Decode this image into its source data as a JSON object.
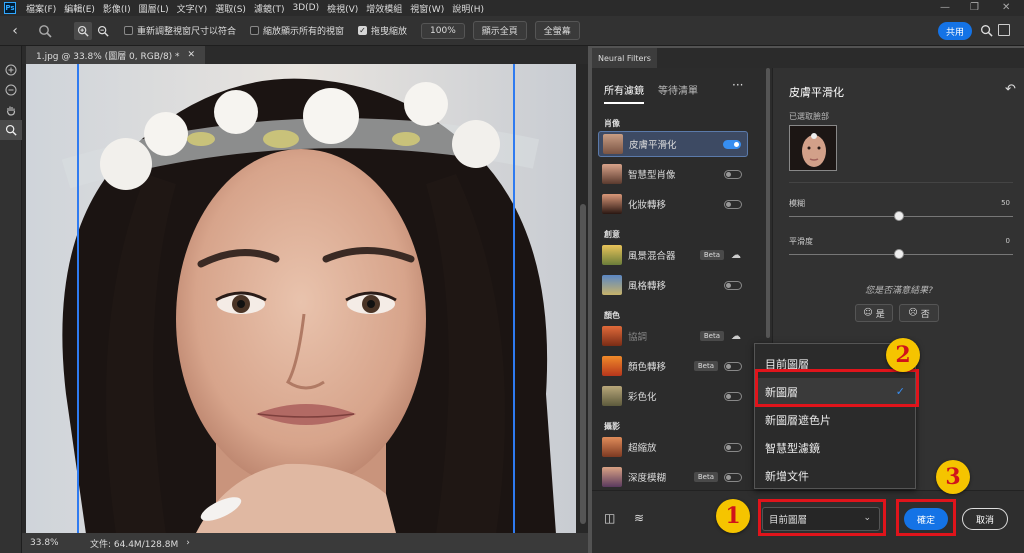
{
  "menubar": {
    "app_icon": "Ps",
    "items": [
      "檔案(F)",
      "編輯(E)",
      "影像(I)",
      "圖層(L)",
      "文字(Y)",
      "選取(S)",
      "濾鏡(T)",
      "3D(D)",
      "檢視(V)",
      "增效模組",
      "視窗(W)",
      "說明(H)"
    ]
  },
  "optionsbar": {
    "resize_windows": "重新調整視窗尺寸以符合",
    "zoom_all_windows": "縮放顯示所有的視窗",
    "scrubby_zoom": "拖曳縮放",
    "zoom_pct": "100%",
    "fit_screen": "顯示全頁",
    "fill_screen": "全螢幕",
    "share": "共用"
  },
  "document": {
    "tab_title": "1.jpg @ 33.8% (圖層 0, RGB/8) *",
    "status_zoom": "33.8%",
    "status_doc": "文件: 64.4M/128.8M"
  },
  "neural_filters": {
    "panel_title": "Neural Filters",
    "tabs": [
      "所有濾鏡",
      "等待清單"
    ],
    "more": "···",
    "categories": {
      "portrait": "肖像",
      "creative": "創意",
      "color": "顏色",
      "photography": "攝影"
    },
    "filters": [
      {
        "name": "皮膚平滑化",
        "state": "on"
      },
      {
        "name": "智慧型肖像",
        "state": "off"
      },
      {
        "name": "化妝轉移",
        "state": "off"
      },
      {
        "name": "風景混合器",
        "beta": "Beta",
        "state": "cloud"
      },
      {
        "name": "風格轉移",
        "state": "off"
      },
      {
        "name": "協調",
        "beta": "Beta",
        "state": "cloud"
      },
      {
        "name": "顏色轉移",
        "beta": "Beta",
        "state": "off"
      },
      {
        "name": "彩色化",
        "state": "off"
      },
      {
        "name": "超縮放",
        "state": "off"
      },
      {
        "name": "深度模糊",
        "beta": "Beta",
        "state": "off"
      }
    ],
    "settings": {
      "title": "皮膚平滑化",
      "selected_face": "已選取臉部",
      "blur_label": "模糊",
      "blur_value": "50",
      "smoothness_label": "平滑度",
      "smoothness_value": "0",
      "satisfied_q": "您是否滿意結果?",
      "yes": "是",
      "no": "否"
    },
    "output": {
      "selected": "目前圖層",
      "options": [
        "目前圖層",
        "新圖層",
        "新圖層遮色片",
        "智慧型濾鏡",
        "新增文件"
      ],
      "checked": "新圖層"
    },
    "ok": "確定",
    "cancel": "取消"
  },
  "callouts": [
    "1",
    "2",
    "3"
  ],
  "colors": {
    "accent": "#1473e6",
    "callout_border": "#e0141b",
    "callout_badge": "#f5c400"
  }
}
